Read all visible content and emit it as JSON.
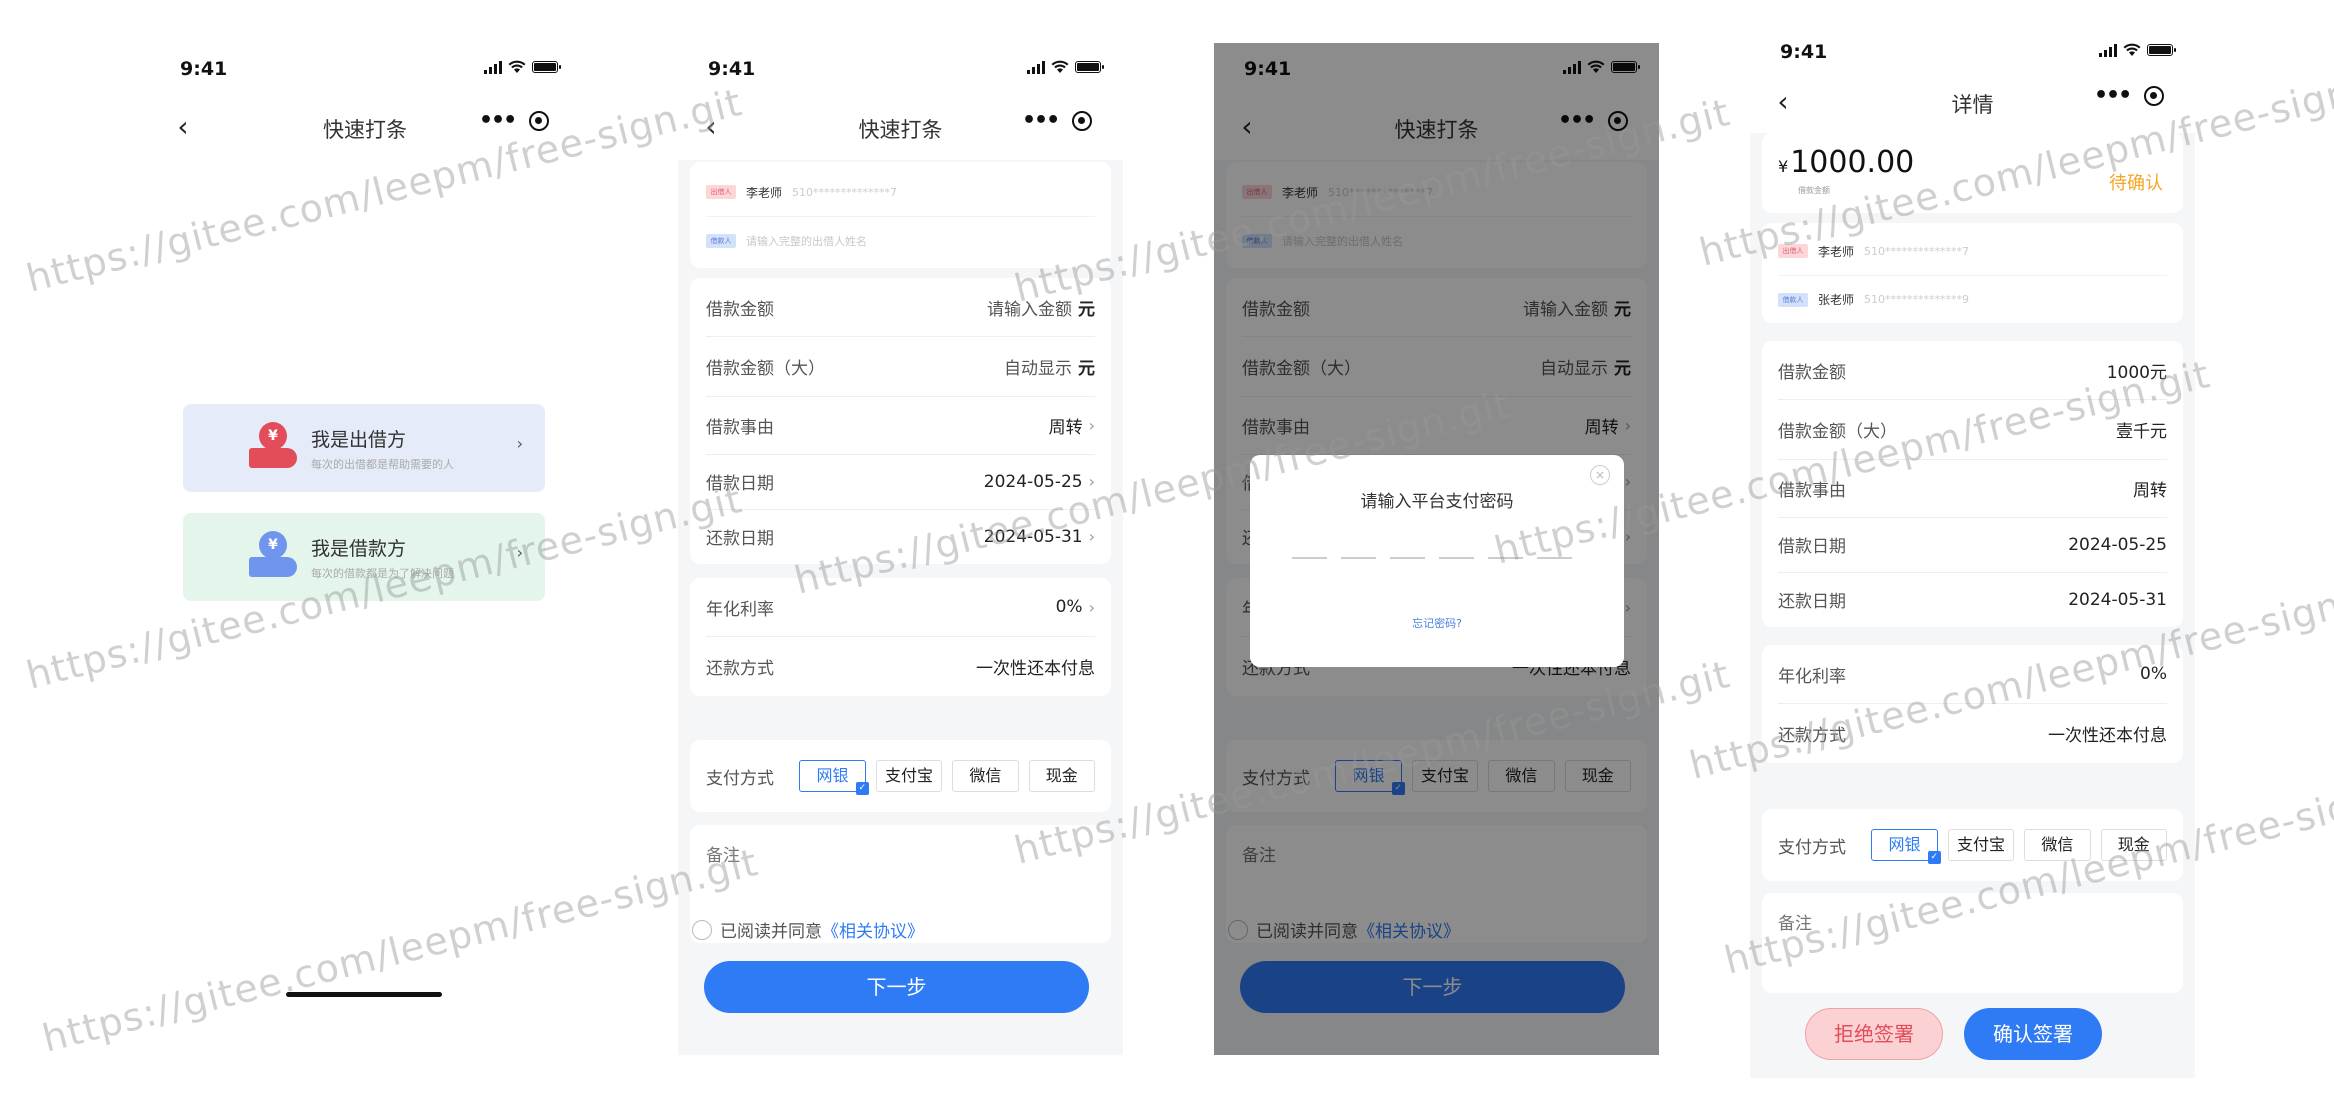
{
  "status": {
    "time": "9:41"
  },
  "screen1": {
    "nav_title": "快速打条",
    "lender": {
      "icon_symbol": "¥",
      "title": "我是出借方",
      "subtitle": "每次的出借都是帮助需要的人",
      "arrow": "›"
    },
    "borrower": {
      "icon_symbol": "¥",
      "title": "我是借款方",
      "subtitle": "每次的借款都是为了解决问题",
      "arrow": "›"
    }
  },
  "screen2": {
    "nav_title": "快速打条",
    "lender_tag": "出借人",
    "lender_name": "李老师",
    "lender_id": "510**************7",
    "borrower_tag": "借款人",
    "borrower_placeholder": "请输入完整的出借人姓名",
    "rows1": [
      {
        "label": "借款金额",
        "value": "请输入金额",
        "unit": "元"
      },
      {
        "label": "借款金额（大）",
        "value": "自动显示",
        "unit": "元"
      },
      {
        "label": "借款事由",
        "value": "周转",
        "arrow": "›"
      },
      {
        "label": "借款日期",
        "value": "2024-05-25",
        "arrow": "›"
      },
      {
        "label": "还款日期",
        "value": "2024-05-31",
        "arrow": "›"
      }
    ],
    "rows2": [
      {
        "label": "年化利率",
        "value": "0%",
        "arrow": "›"
      },
      {
        "label": "还款方式",
        "value": "一次性还本付息"
      }
    ],
    "pay_label": "支付方式",
    "pay_options": [
      "网银",
      "支付宝",
      "微信",
      "现金"
    ],
    "remark_label": "备注",
    "agree_text": "已阅读并同意",
    "agree_link": "《相关协议》",
    "next_button": "下一步"
  },
  "screen3": {
    "modal_title": "请输入平台支付密码",
    "close_symbol": "×",
    "forgot": "忘记密码?"
  },
  "screen4": {
    "nav_title": "详情",
    "currency": "¥",
    "amount": "1000.00",
    "amount_sub": "借款金额",
    "status": "待确认",
    "lender_tag": "出借人",
    "lender_name": "李老师",
    "lender_id": "510**************7",
    "borrower_tag": "借款人",
    "borrower_name": "张老师",
    "borrower_id": "510**************9",
    "rows1": [
      {
        "label": "借款金额",
        "value": "1000元"
      },
      {
        "label": "借款金额（大）",
        "value": "壹千元"
      },
      {
        "label": "借款事由",
        "value": "周转"
      },
      {
        "label": "借款日期",
        "value": "2024-05-25"
      },
      {
        "label": "还款日期",
        "value": "2024-05-31"
      }
    ],
    "rows2": [
      {
        "label": "年化利率",
        "value": "0%"
      },
      {
        "label": "还款方式",
        "value": "一次性还本付息"
      }
    ],
    "pay_label": "支付方式",
    "pay_options": [
      "网银",
      "支付宝",
      "微信",
      "现金"
    ],
    "remark_label": "备注",
    "reject_button": "拒绝签署",
    "confirm_button": "确认签署"
  },
  "watermark": "https://gitee.com/leepm/free-sign.git",
  "colors": {
    "primary": "#2f7bf5",
    "pending": "#f5a623",
    "reject": "#e34d59",
    "lender_card": "#e6ebfa",
    "borrower_card": "#e4f6ec"
  }
}
